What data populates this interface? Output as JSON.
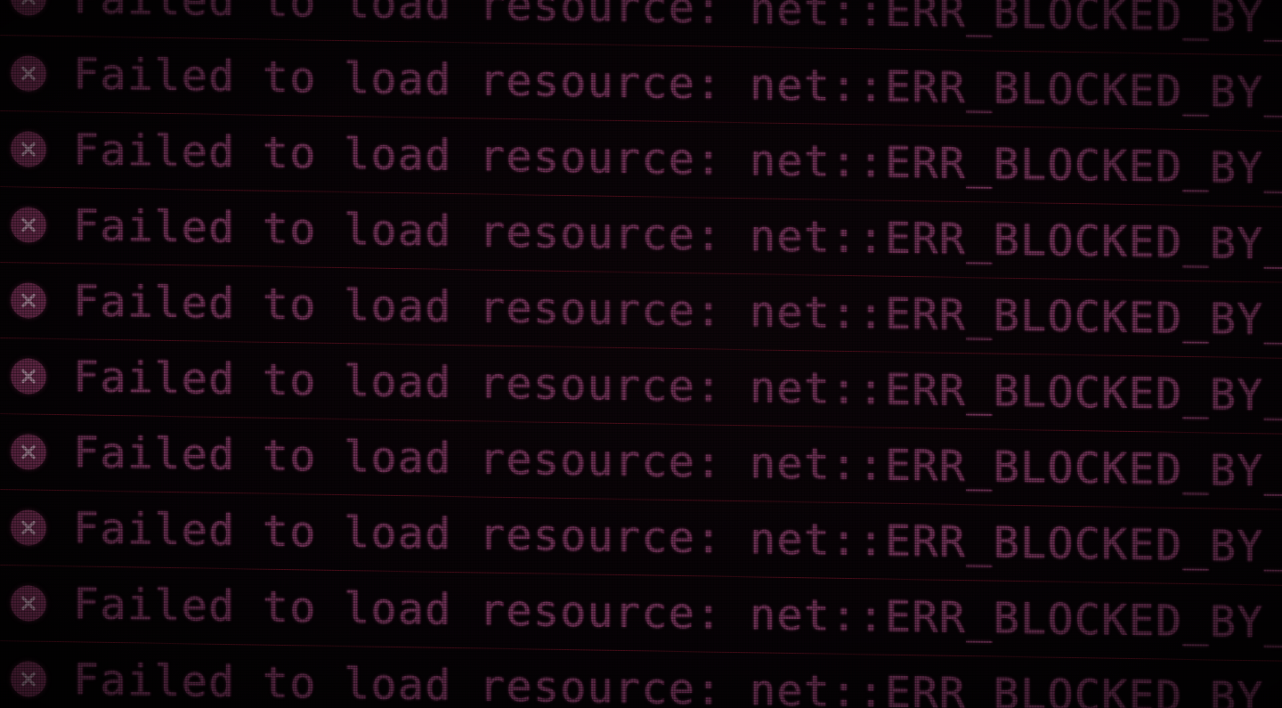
{
  "console": {
    "entries": [
      {
        "level": "error",
        "icon": "error-x-icon",
        "message": "Failed to load resource: net::ERR_BLOCKED_BY_AD"
      },
      {
        "level": "error",
        "icon": "error-x-icon",
        "message": "Failed to load resource: net::ERR_BLOCKED_BY_AD"
      },
      {
        "level": "error",
        "icon": "error-x-icon",
        "message": "Failed to load resource: net::ERR_BLOCKED_BY_AD"
      },
      {
        "level": "error",
        "icon": "error-x-icon",
        "message": "Failed to load resource: net::ERR_BLOCKED_BY_AD"
      },
      {
        "level": "error",
        "icon": "error-x-icon",
        "message": "Failed to load resource: net::ERR_BLOCKED_BY_AD"
      },
      {
        "level": "error",
        "icon": "error-x-icon",
        "message": "Failed to load resource: net::ERR_BLOCKED_BY_AD"
      },
      {
        "level": "error",
        "icon": "error-x-icon",
        "message": "Failed to load resource: net::ERR_BLOCKED_BY_AD"
      },
      {
        "level": "error",
        "icon": "error-x-icon",
        "message": "Failed to load resource: net::ERR_BLOCKED_BY_AD"
      },
      {
        "level": "error",
        "icon": "error-x-icon",
        "message": "Failed to load resource: net::ERR_BLOCKED_BY_AD"
      },
      {
        "level": "error",
        "icon": "error-x-icon",
        "message": "Failed to load resource: net::ERR_BLOCKED_BY_AD"
      }
    ]
  },
  "colors": {
    "background": "#070306",
    "message_text": "#6a3052",
    "error_icon": "#6b2b4d",
    "row_divider": "#4a0d1a"
  }
}
